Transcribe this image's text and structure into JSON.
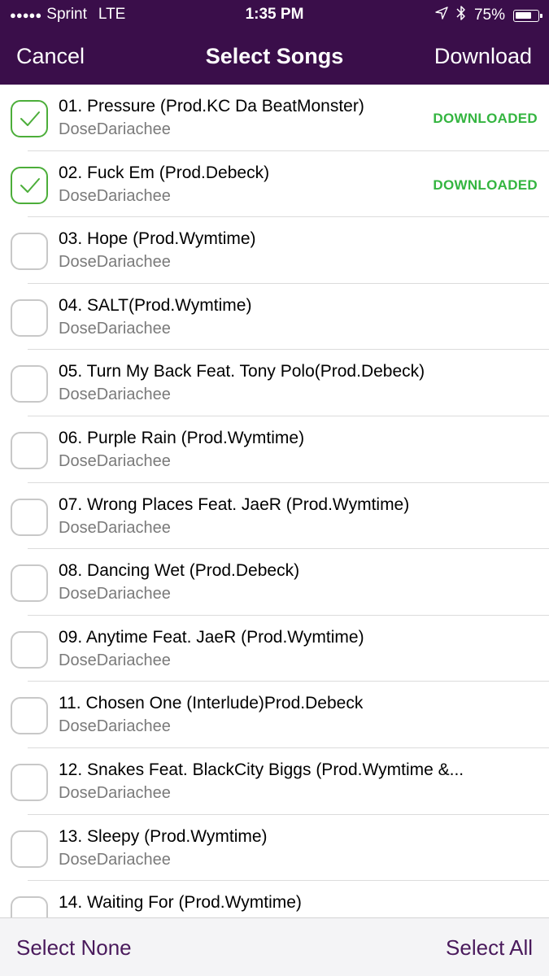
{
  "status_bar": {
    "signal": "●●●●●",
    "carrier": "Sprint",
    "network": "LTE",
    "time": "1:35 PM",
    "battery": "75%",
    "battery_level": 0.75
  },
  "nav": {
    "cancel_label": "Cancel",
    "title": "Select Songs",
    "download_label": "Download"
  },
  "songs": [
    {
      "title": "01. Pressure (Prod.KC Da BeatMonster)",
      "artist": "DoseDariachee",
      "checked": true,
      "badge": "DOWNLOADED"
    },
    {
      "title": "02. Fuck Em (Prod.Debeck)",
      "artist": "DoseDariachee",
      "checked": true,
      "badge": "DOWNLOADED"
    },
    {
      "title": "03. Hope (Prod.Wymtime)",
      "artist": "DoseDariachee",
      "checked": false,
      "badge": ""
    },
    {
      "title": "04. SALT(Prod.Wymtime)",
      "artist": "DoseDariachee",
      "checked": false,
      "badge": ""
    },
    {
      "title": "05. Turn My Back Feat. Tony Polo(Prod.Debeck)",
      "artist": "DoseDariachee",
      "checked": false,
      "badge": ""
    },
    {
      "title": "06. Purple Rain (Prod.Wymtime)",
      "artist": "DoseDariachee",
      "checked": false,
      "badge": ""
    },
    {
      "title": "07. Wrong Places Feat. JaeR (Prod.Wymtime)",
      "artist": "DoseDariachee",
      "checked": false,
      "badge": ""
    },
    {
      "title": "08. Dancing Wet (Prod.Debeck)",
      "artist": "DoseDariachee",
      "checked": false,
      "badge": ""
    },
    {
      "title": "09. Anytime Feat. JaeR (Prod.Wymtime)",
      "artist": "DoseDariachee",
      "checked": false,
      "badge": ""
    },
    {
      "title": "11. Chosen One (Interlude)Prod.Debeck",
      "artist": "DoseDariachee",
      "checked": false,
      "badge": ""
    },
    {
      "title": "12. Snakes Feat. BlackCity Biggs (Prod.Wymtime &...",
      "artist": "DoseDariachee",
      "checked": false,
      "badge": ""
    },
    {
      "title": "13. Sleepy (Prod.Wymtime)",
      "artist": "DoseDariachee",
      "checked": false,
      "badge": ""
    },
    {
      "title": "14. Waiting For (Prod.Wymtime)",
      "artist": "",
      "checked": false,
      "badge": ""
    }
  ],
  "toolbar": {
    "select_none_label": "Select None",
    "select_all_label": "Select All"
  },
  "colors": {
    "header_bg": "#3a0e4a",
    "check_green": "#4cae3a",
    "badge_green": "#34b540",
    "toolbar_text": "#4a1a5c"
  },
  "icons": {
    "location": "location-arrow-icon",
    "bluetooth": "bluetooth-icon",
    "battery": "battery-icon",
    "check": "checkmark-icon"
  }
}
